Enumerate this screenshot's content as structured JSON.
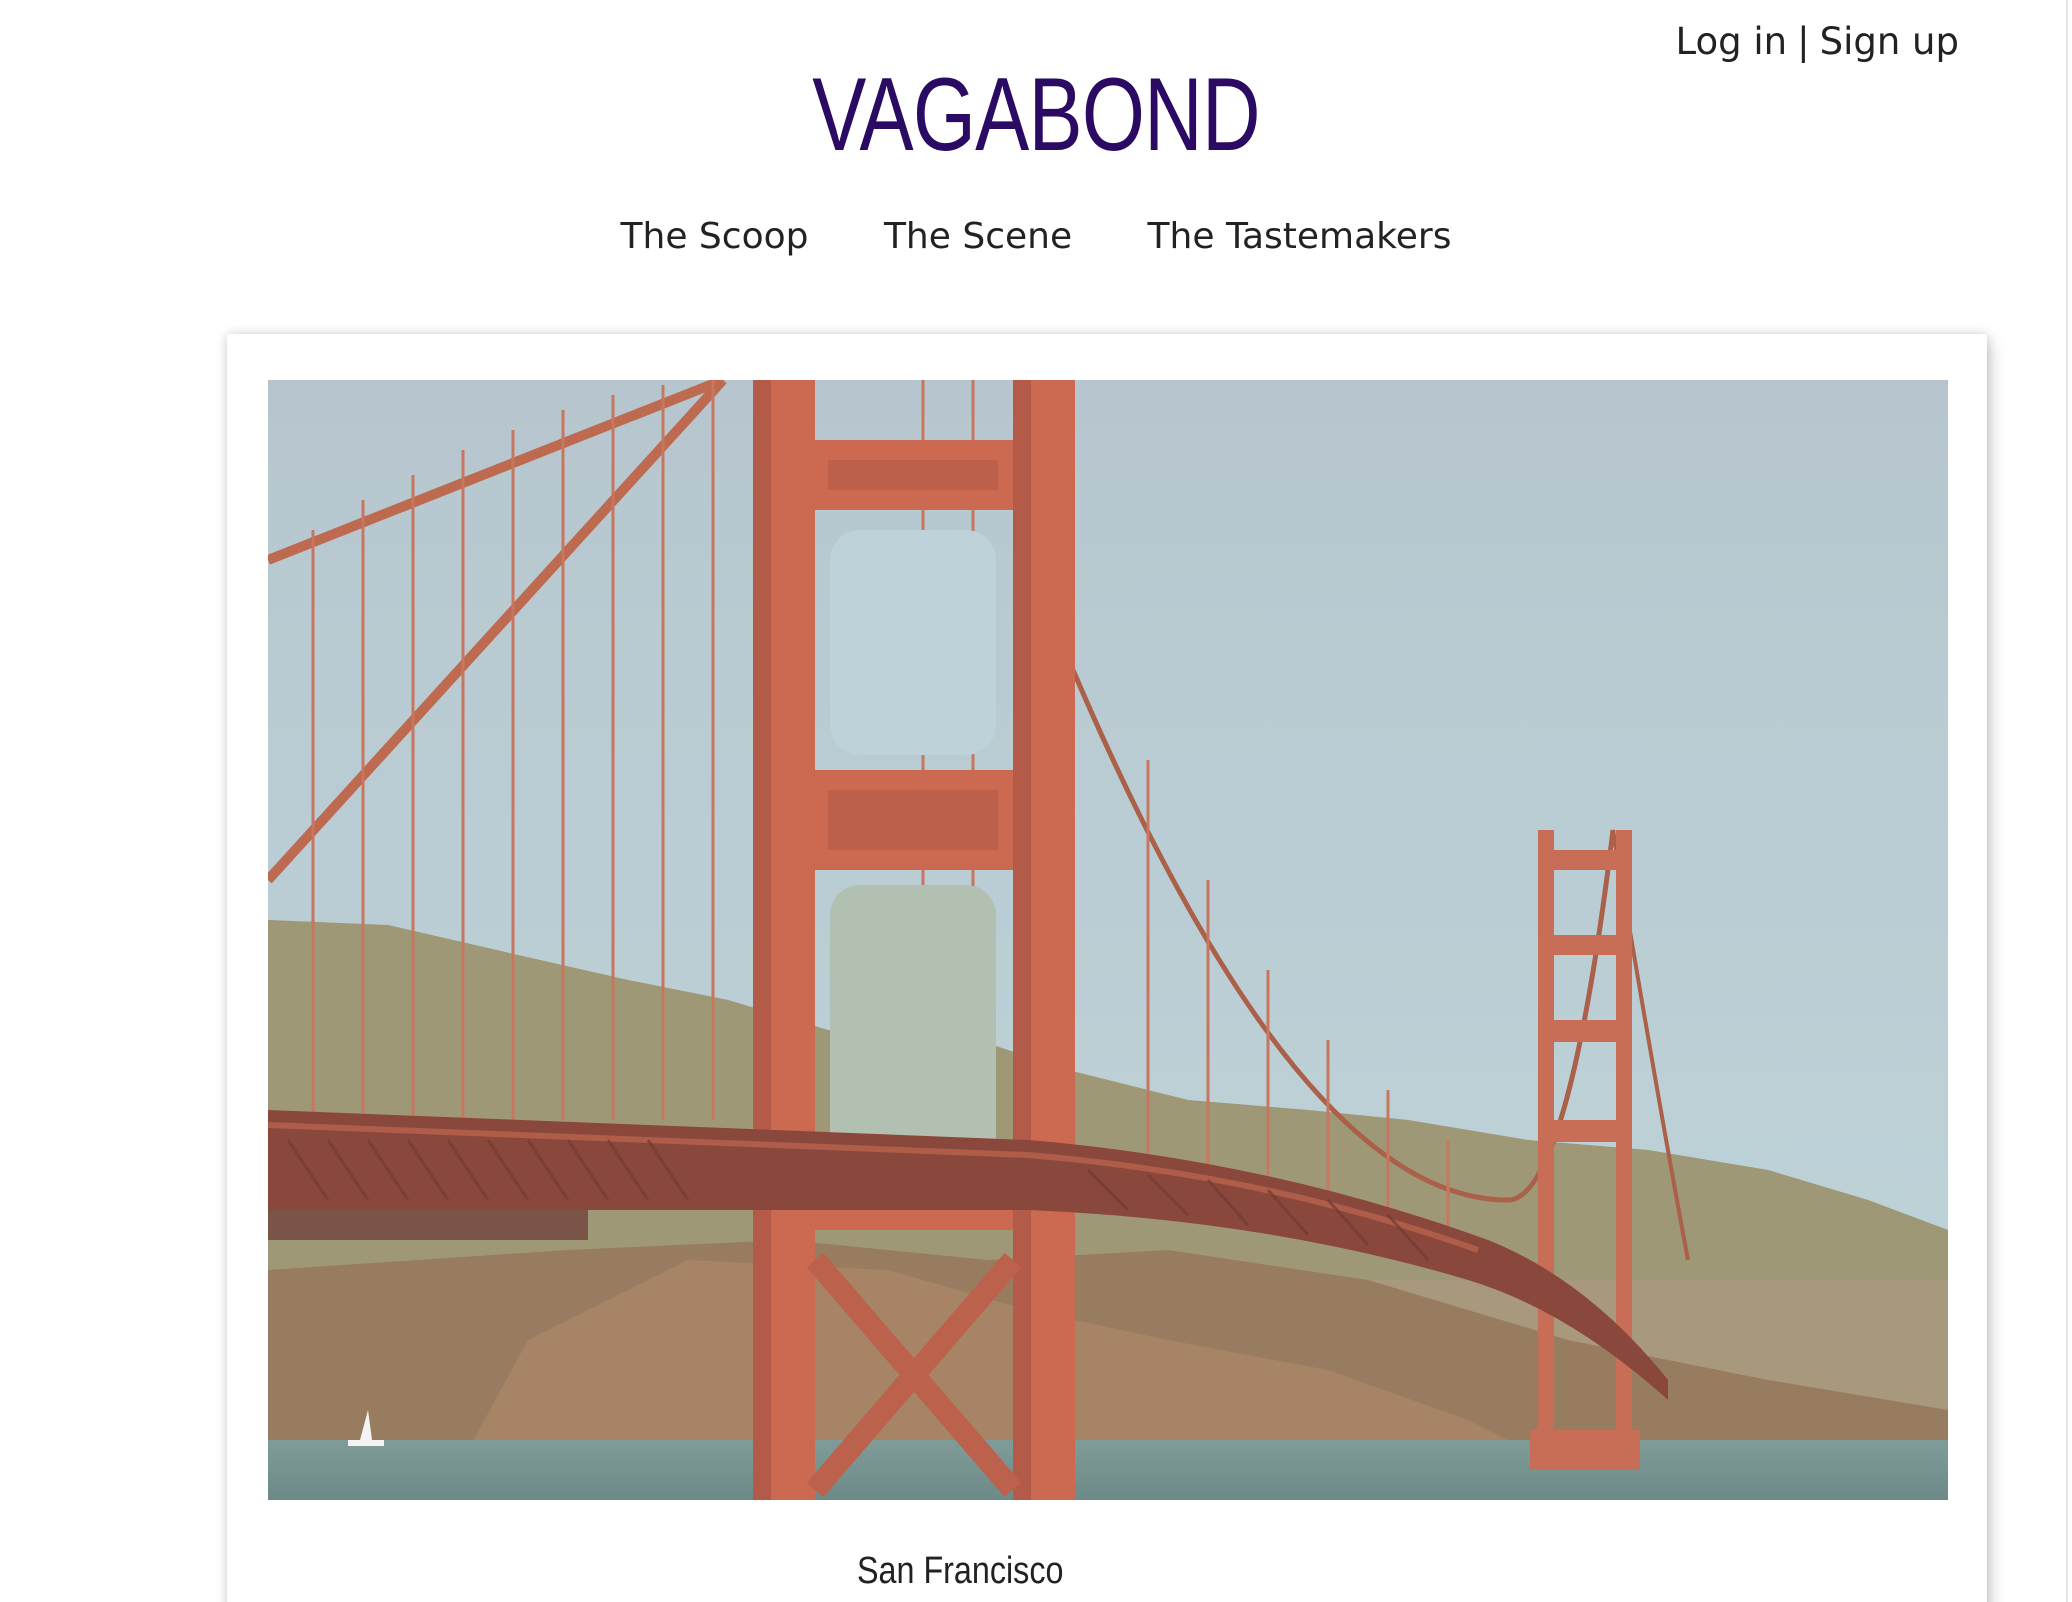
{
  "header": {
    "login_label": "Log in",
    "separator": "|",
    "signup_label": "Sign up",
    "brand": "VAGABOND",
    "brand_color": "#2a0a63"
  },
  "nav": {
    "items": [
      {
        "label": "The Scoop"
      },
      {
        "label": "The Scene"
      },
      {
        "label": "The Tastemakers"
      }
    ]
  },
  "feature": {
    "caption": "San Francisco"
  }
}
